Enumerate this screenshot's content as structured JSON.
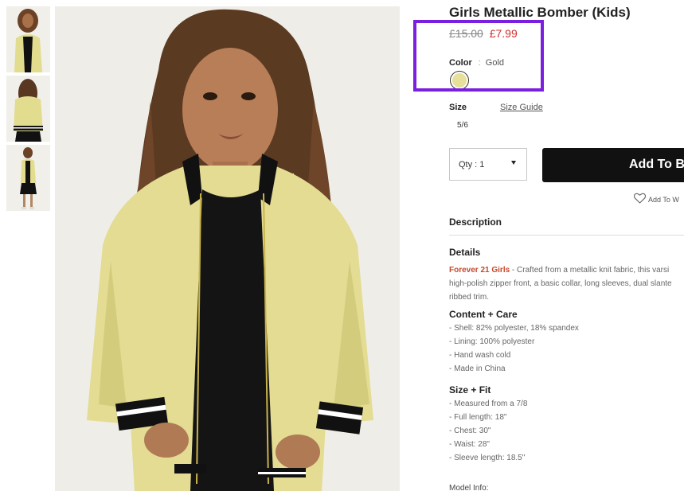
{
  "product": {
    "title": "Girls Metallic Bomber (Kids)",
    "old_price": "£15.00",
    "new_price": "£7.99",
    "color_label": "Color",
    "color_separator": ":",
    "color_value": "Gold",
    "swatch_color": "#e6e09a",
    "size_label": "Size",
    "size_guide_label": "Size Guide",
    "size_option": "5/6",
    "qty_label": "Qty : 1",
    "add_button_label": "Add To B",
    "wishlist_label": "Add To W"
  },
  "description": {
    "heading": "Description"
  },
  "details": {
    "heading": "Details",
    "brand": "Forever 21 Girls",
    "line1_rest": " - Crafted from a metallic knit fabric, this varsi",
    "line2": "high-polish zipper front, a basic collar, long sleeves, dual slante",
    "line3": "ribbed trim."
  },
  "content_care": {
    "heading": "Content + Care",
    "items": [
      "- Shell: 82% polyester, 18% spandex",
      "- Lining: 100% polyester",
      "- Hand wash cold",
      "- Made in China"
    ]
  },
  "size_fit": {
    "heading": "Size + Fit",
    "items": [
      "- Measured from a 7/8",
      "- Full length: 18\"",
      "- Chest: 30\"",
      "- Waist: 28\"",
      "- Sleeve length: 18.5\""
    ]
  },
  "model_info": "Model Info:",
  "colors": {
    "price_sale": "#d0312d",
    "highlight": "#7a1fe0",
    "button_bg": "#111111",
    "brand_text": "#c8482b",
    "jacket": "#e6e09a"
  },
  "images": {
    "thumbnails": [
      "jacket-front-thumb",
      "jacket-back-thumb",
      "jacket-full-thumb"
    ],
    "main": "girl-wearing-gold-bomber-jacket"
  }
}
